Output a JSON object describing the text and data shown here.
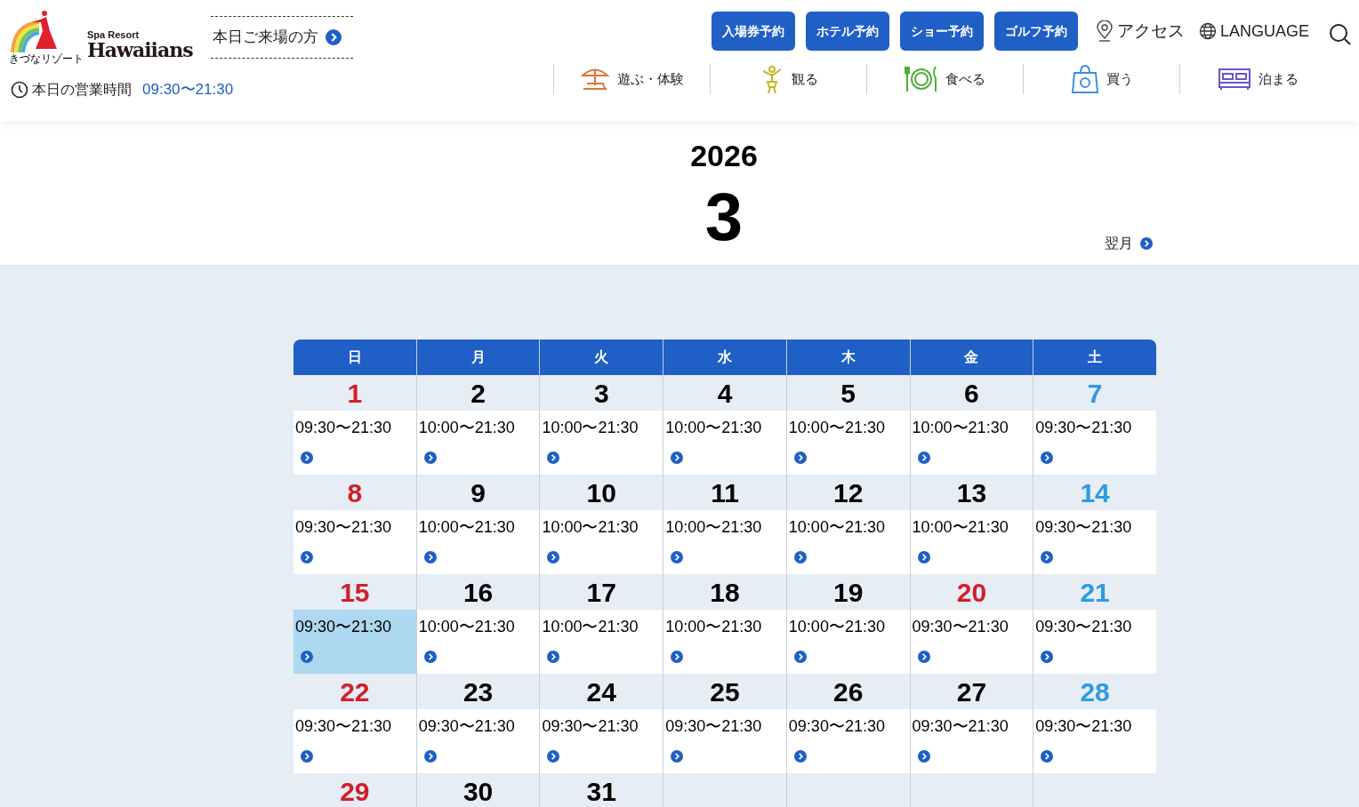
{
  "header": {
    "logo": {
      "tagline": "きづなリゾート",
      "sub": "Spa Resort",
      "name": "Hawaiians"
    },
    "visitor_link": "本日ご来場の方",
    "hours_label": "本日の営業時間",
    "hours_value": "09:30〜21:30",
    "booking_buttons": [
      "入場券予約",
      "ホテル予約",
      "ショー予約",
      "ゴルフ予約"
    ],
    "access": "アクセス",
    "language": "LANGUAGE",
    "nav": [
      {
        "label": "遊ぶ・体験",
        "kind": "play"
      },
      {
        "label": "観る",
        "kind": "watch"
      },
      {
        "label": "食べる",
        "kind": "eat"
      },
      {
        "label": "買う",
        "kind": "shop"
      },
      {
        "label": "泊まる",
        "kind": "stay"
      }
    ]
  },
  "month_header": {
    "year": "2026",
    "month": "3",
    "next": "翌月"
  },
  "calendar": {
    "weekdays": [
      "日",
      "月",
      "火",
      "水",
      "木",
      "金",
      "土"
    ],
    "weeks": [
      [
        {
          "day": "1",
          "kind": "sunday",
          "hours": "09:30〜21:30",
          "selected": false
        },
        {
          "day": "2",
          "kind": "weekday",
          "hours": "10:00〜21:30",
          "selected": false
        },
        {
          "day": "3",
          "kind": "weekday",
          "hours": "10:00〜21:30",
          "selected": false
        },
        {
          "day": "4",
          "kind": "weekday",
          "hours": "10:00〜21:30",
          "selected": false
        },
        {
          "day": "5",
          "kind": "weekday",
          "hours": "10:00〜21:30",
          "selected": false
        },
        {
          "day": "6",
          "kind": "weekday",
          "hours": "10:00〜21:30",
          "selected": false
        },
        {
          "day": "7",
          "kind": "saturday",
          "hours": "09:30〜21:30",
          "selected": false
        }
      ],
      [
        {
          "day": "8",
          "kind": "sunday",
          "hours": "09:30〜21:30",
          "selected": false
        },
        {
          "day": "9",
          "kind": "weekday",
          "hours": "10:00〜21:30",
          "selected": false
        },
        {
          "day": "10",
          "kind": "weekday",
          "hours": "10:00〜21:30",
          "selected": false
        },
        {
          "day": "11",
          "kind": "weekday",
          "hours": "10:00〜21:30",
          "selected": false
        },
        {
          "day": "12",
          "kind": "weekday",
          "hours": "10:00〜21:30",
          "selected": false
        },
        {
          "day": "13",
          "kind": "weekday",
          "hours": "10:00〜21:30",
          "selected": false
        },
        {
          "day": "14",
          "kind": "saturday",
          "hours": "09:30〜21:30",
          "selected": false
        }
      ],
      [
        {
          "day": "15",
          "kind": "sunday",
          "hours": "09:30〜21:30",
          "selected": true
        },
        {
          "day": "16",
          "kind": "weekday",
          "hours": "10:00〜21:30",
          "selected": false
        },
        {
          "day": "17",
          "kind": "weekday",
          "hours": "10:00〜21:30",
          "selected": false
        },
        {
          "day": "18",
          "kind": "weekday",
          "hours": "10:00〜21:30",
          "selected": false
        },
        {
          "day": "19",
          "kind": "weekday",
          "hours": "10:00〜21:30",
          "selected": false
        },
        {
          "day": "20",
          "kind": "holiday",
          "hours": "09:30〜21:30",
          "selected": false
        },
        {
          "day": "21",
          "kind": "saturday",
          "hours": "09:30〜21:30",
          "selected": false
        }
      ],
      [
        {
          "day": "22",
          "kind": "sunday",
          "hours": "09:30〜21:30",
          "selected": false
        },
        {
          "day": "23",
          "kind": "weekday",
          "hours": "09:30〜21:30",
          "selected": false
        },
        {
          "day": "24",
          "kind": "weekday",
          "hours": "09:30〜21:30",
          "selected": false
        },
        {
          "day": "25",
          "kind": "weekday",
          "hours": "09:30〜21:30",
          "selected": false
        },
        {
          "day": "26",
          "kind": "weekday",
          "hours": "09:30〜21:30",
          "selected": false
        },
        {
          "day": "27",
          "kind": "weekday",
          "hours": "09:30〜21:30",
          "selected": false
        },
        {
          "day": "28",
          "kind": "saturday",
          "hours": "09:30〜21:30",
          "selected": false
        }
      ],
      [
        {
          "day": "29",
          "kind": "sunday"
        },
        {
          "day": "30",
          "kind": "weekday"
        },
        {
          "day": "31",
          "kind": "weekday"
        },
        {
          "kind": "empty"
        },
        {
          "kind": "empty"
        },
        {
          "kind": "empty"
        },
        {
          "kind": "empty"
        }
      ]
    ]
  }
}
